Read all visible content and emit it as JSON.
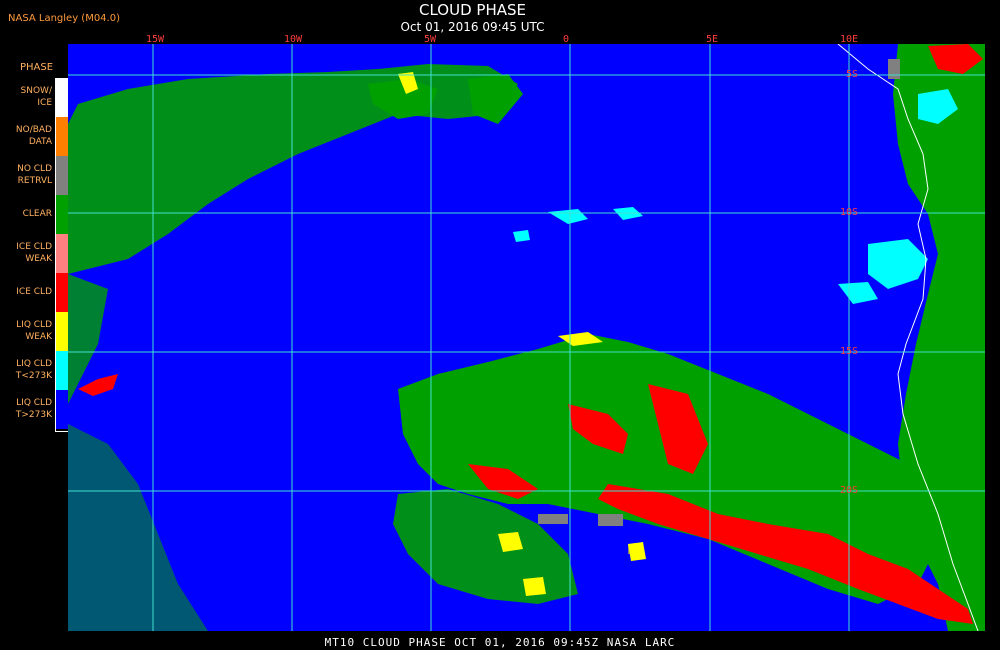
{
  "header": {
    "credit": "NASA Langley  (M04.0)",
    "title": "CLOUD PHASE",
    "subtitle": "Oct 01, 2016 09:45 UTC"
  },
  "legend": {
    "title": "PHASE",
    "items": [
      {
        "label": "SNOW/\nICE",
        "color": "#ffffff"
      },
      {
        "label": "NO/BAD\nDATA",
        "color": "#ff8000"
      },
      {
        "label": "NO CLD\nRETRVL",
        "color": "#808080"
      },
      {
        "label": "CLEAR",
        "color": "#00a000"
      },
      {
        "label": "ICE CLD\nWEAK",
        "color": "#ff8080"
      },
      {
        "label": "ICE CLD",
        "color": "#ff0000"
      },
      {
        "label": "LIQ CLD\nWEAK",
        "color": "#ffff00"
      },
      {
        "label": "LIQ CLD\nT<273K",
        "color": "#00ffff"
      },
      {
        "label": "LIQ CLD\nT>273K",
        "color": "#0000ff"
      }
    ]
  },
  "grid": {
    "longitudes": [
      "15W",
      "10W",
      "5W",
      "0",
      "5E",
      "10E"
    ],
    "latitudes": [
      "5S",
      "10S",
      "15S",
      "20S"
    ],
    "color": "#40e0d0"
  },
  "footer": {
    "text": "MT10  CLOUD PHASE  OCT 01, 2016 09:45Z  NASA LARC"
  }
}
